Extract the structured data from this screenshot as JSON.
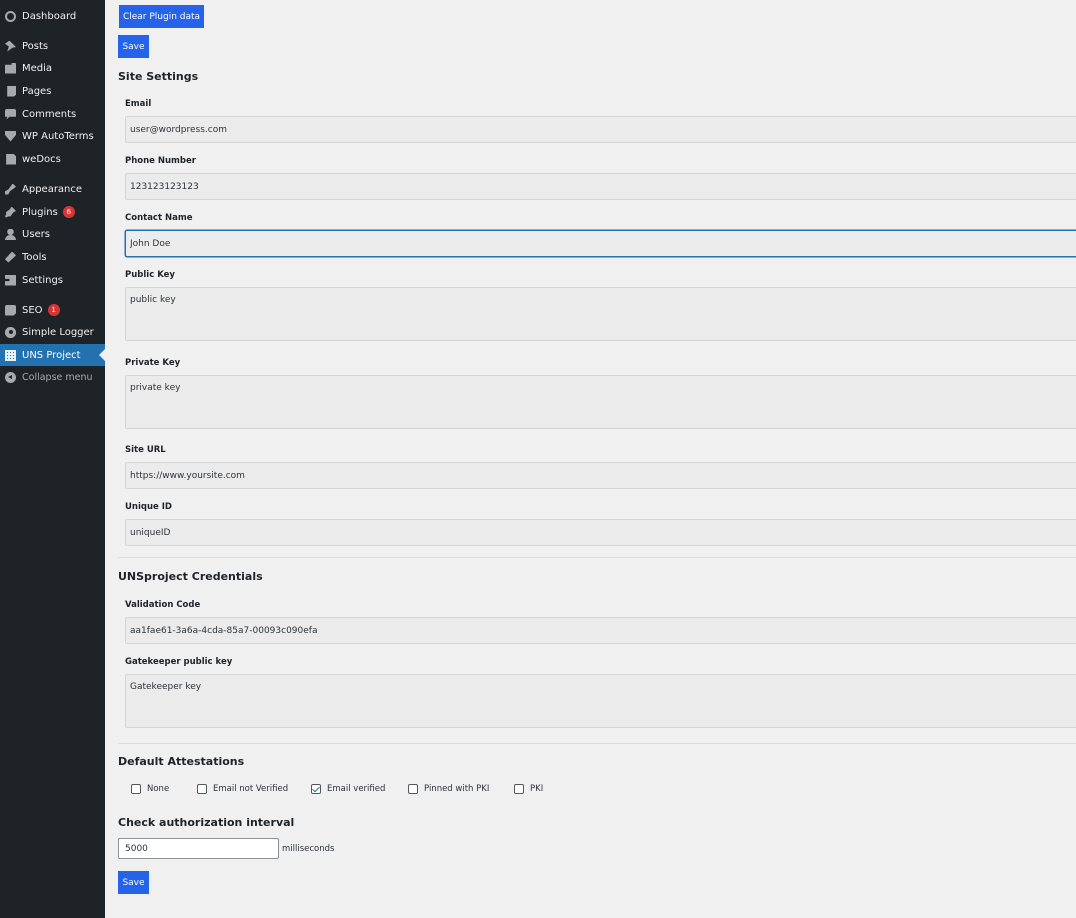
{
  "sidebar": {
    "items": [
      {
        "label": "Dashboard",
        "icon": "dashboard-icon"
      },
      {
        "label": "Posts",
        "icon": "pin-icon"
      },
      {
        "label": "Media",
        "icon": "media-icon"
      },
      {
        "label": "Pages",
        "icon": "pages-icon"
      },
      {
        "label": "Comments",
        "icon": "comment-icon"
      },
      {
        "label": "WP AutoTerms",
        "icon": "tag-icon"
      },
      {
        "label": "weDocs",
        "icon": "document-icon"
      },
      {
        "label": "Appearance",
        "icon": "paintbrush-icon"
      },
      {
        "label": "Plugins",
        "icon": "plugin-icon",
        "badge": "6"
      },
      {
        "label": "Users",
        "icon": "user-icon"
      },
      {
        "label": "Tools",
        "icon": "wrench-icon"
      },
      {
        "label": "Settings",
        "icon": "settings-icon"
      },
      {
        "label": "SEO",
        "icon": "seo-icon",
        "badge": "1"
      },
      {
        "label": "Simple Logger",
        "icon": "gear-icon"
      },
      {
        "label": "UNS Project",
        "icon": "grid-icon"
      },
      {
        "label": "Collapse menu",
        "icon": "collapse-icon"
      }
    ]
  },
  "actions": {
    "clear_label": "Clear Plugin data",
    "save_label": "Save"
  },
  "site_settings": {
    "heading": "Site Settings",
    "email": {
      "label": "Email",
      "value": "user@wordpress.com"
    },
    "phone": {
      "label": "Phone Number",
      "value": "123123123123"
    },
    "contact": {
      "label": "Contact Name",
      "value": "John Doe"
    },
    "public_key": {
      "label": "Public Key",
      "value": "public key"
    },
    "private_key": {
      "label": "Private Key",
      "value": "private key"
    },
    "site_url": {
      "label": "Site URL",
      "value": "https://www.yoursite.com"
    },
    "unique_id": {
      "label": "Unique ID",
      "value": "uniqueID"
    }
  },
  "credentials": {
    "heading": "UNSproject Credentials",
    "validation_code": {
      "label": "Validation Code",
      "value": "aa1fae61-3a6a-4cda-85a7-00093c090efa"
    },
    "gatekeeper": {
      "label": "Gatekeeper public key",
      "value": "Gatekeeper key"
    }
  },
  "attestations": {
    "heading": "Default Attestations",
    "options": [
      {
        "label": "None",
        "checked": false
      },
      {
        "label": "Email not Verified",
        "checked": false
      },
      {
        "label": "Email verified",
        "checked": true
      },
      {
        "label": "Pinned with PKI",
        "checked": false
      },
      {
        "label": "PKI",
        "checked": false
      }
    ]
  },
  "interval": {
    "heading": "Check authorization interval",
    "value": "5000",
    "unit": "milliseconds"
  },
  "colors": {
    "sidebar_bg": "#1d2327",
    "active_menu": "#2271b1",
    "button": "#2563eb",
    "badge": "#d63638"
  }
}
